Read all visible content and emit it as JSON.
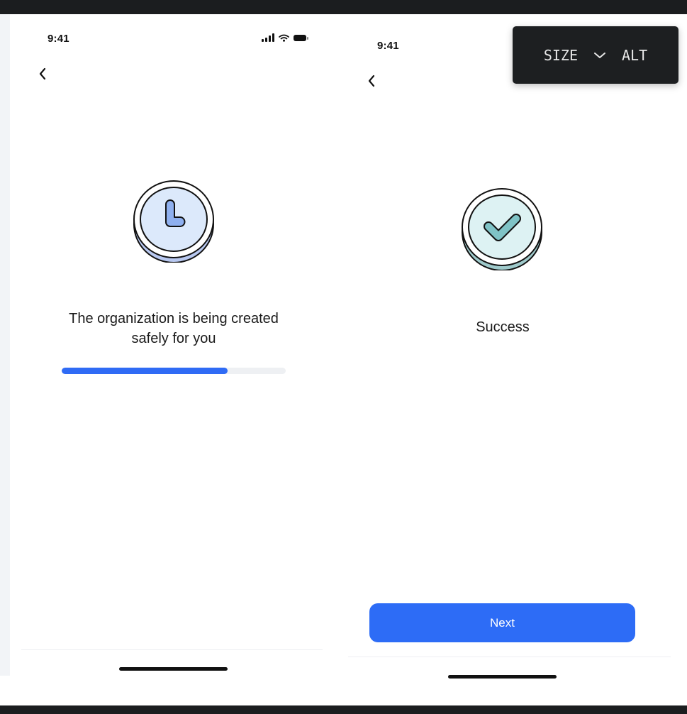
{
  "screens": [
    {
      "status_time": "9:41",
      "message": "The organization is being created safely for you",
      "progress": 0.74,
      "icon": "clock-icon",
      "accent": "#2f6bf5"
    },
    {
      "status_time": "9:41",
      "message": "Success",
      "icon": "checkmark-icon",
      "next_label": "Next",
      "accent": "#2d6cf6"
    }
  ],
  "tooltip": {
    "size_label": "SIZE",
    "dropdown_icon": "chevron-down-icon",
    "alt_label": "ALT"
  },
  "colors": {
    "clock_coin": "#dce9fb",
    "clock_coin_edge": "#b8c8f0",
    "check_coin": "#ddf2f3",
    "check_coin_edge": "#9fcacb",
    "button": "#2d6cf6",
    "progress_fill": "#2f6bf5"
  }
}
